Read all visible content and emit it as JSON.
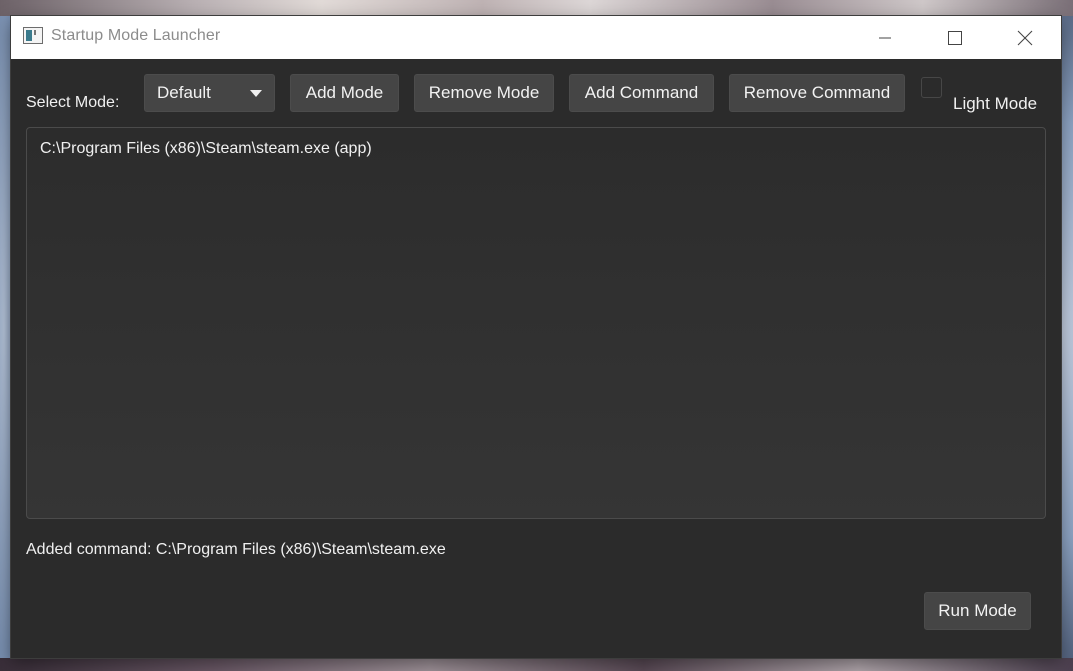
{
  "window": {
    "title": "Startup Mode Launcher"
  },
  "toolbar": {
    "select_mode_label": "Select Mode:",
    "mode_selected": "Default",
    "add_mode": "Add Mode",
    "remove_mode": "Remove Mode",
    "add_command": "Add Command",
    "remove_command": "Remove Command",
    "light_mode_label": "Light Mode",
    "light_mode_checked": false
  },
  "commands": [
    "C:\\Program Files (x86)\\Steam\\steam.exe (app)"
  ],
  "status_text": "Added command: C:\\Program Files (x86)\\Steam\\steam.exe",
  "run_button": "Run Mode",
  "icons": {
    "app": "app-window-icon",
    "minimize": "minimize-icon",
    "maximize": "maximize-icon",
    "close": "close-icon",
    "dropdown": "chevron-down-icon"
  },
  "colors": {
    "window_bg": "#2b2b2b",
    "button_bg": "#454545",
    "text": "#f0f0f0",
    "titlebar_bg": "#ffffff"
  }
}
